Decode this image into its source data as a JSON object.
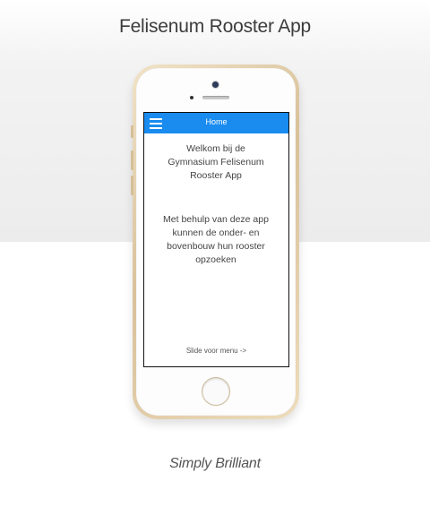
{
  "page": {
    "title": "Felisenum Rooster App",
    "tagline": "Simply Brilliant"
  },
  "app": {
    "appbar": {
      "title": "Home",
      "menu_icon": "hamburger-menu-icon"
    },
    "welcome_lines": [
      "Welkom bij de",
      "Gymnasium Felisenum",
      "Rooster App"
    ],
    "description_lines": [
      "Met behulp van deze app",
      "kunnen de onder- en",
      "bovenbouw hun rooster",
      "opzoeken"
    ],
    "slide_hint": "Slide voor menu ->"
  },
  "colors": {
    "appbar": "#1a8cf0",
    "phone_gold": "#d9c19a"
  }
}
